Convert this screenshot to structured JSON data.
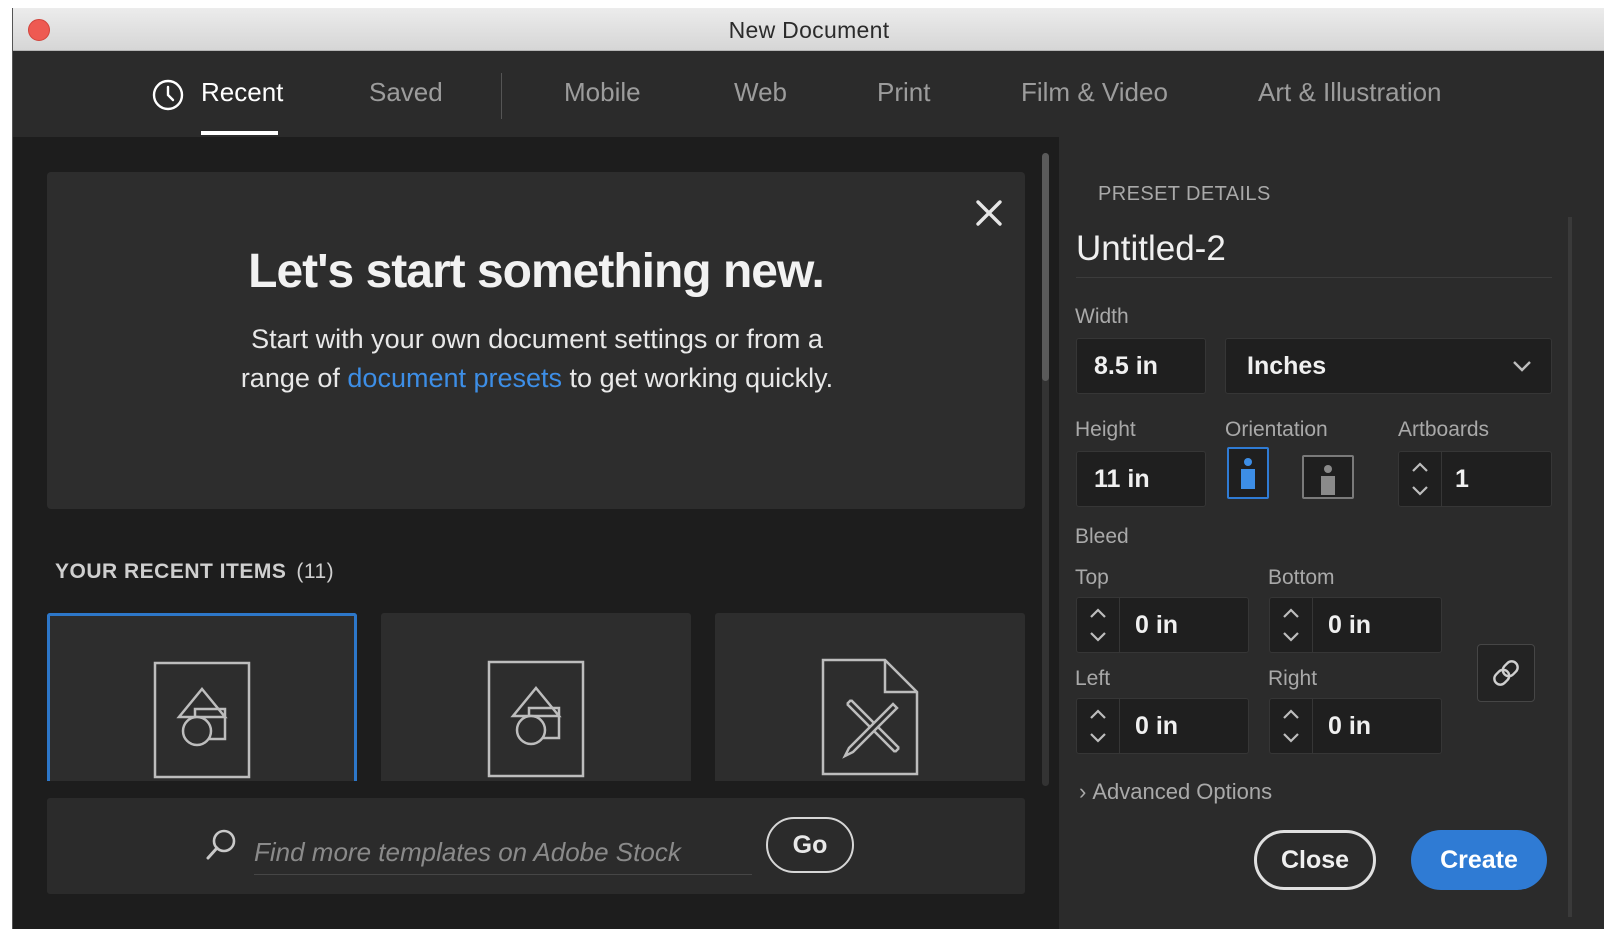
{
  "window": {
    "title": "New Document"
  },
  "tabs": [
    {
      "label": "Recent",
      "active": true
    },
    {
      "label": "Saved"
    },
    {
      "label": "Mobile"
    },
    {
      "label": "Web"
    },
    {
      "label": "Print"
    },
    {
      "label": "Film & Video"
    },
    {
      "label": "Art & Illustration"
    }
  ],
  "hero": {
    "title": "Let's start something new.",
    "text_before": "Start with your own document settings or from a range of",
    "link": "document presets",
    "text_after": "to get working quickly."
  },
  "recent": {
    "heading": "YOUR RECENT ITEMS",
    "count": "(11)",
    "items": [
      {
        "icon": "shapes-document-icon",
        "selected": true
      },
      {
        "icon": "shapes-document-icon",
        "selected": false
      },
      {
        "icon": "ruler-pencil-document-icon",
        "selected": false
      }
    ]
  },
  "stock": {
    "placeholder": "Find more templates on Adobe Stock",
    "go_label": "Go"
  },
  "preset": {
    "heading": "PRESET DETAILS",
    "name": "Untitled-2",
    "width_label": "Width",
    "width_value": "8.5 in",
    "units_value": "Inches",
    "height_label": "Height",
    "height_value": "11 in",
    "orientation_label": "Orientation",
    "orientation_selected": "portrait",
    "artboards_label": "Artboards",
    "artboards_value": "1",
    "bleed_label": "Bleed",
    "top_label": "Top",
    "top_value": "0 in",
    "bottom_label": "Bottom",
    "bottom_value": "0 in",
    "left_label": "Left",
    "left_value": "0 in",
    "right_label": "Right",
    "right_value": "0 in",
    "advanced_label": "Advanced Options",
    "close_label": "Close",
    "create_label": "Create"
  },
  "colors": {
    "accent": "#2f7bd4",
    "link": "#3d8ee6",
    "selection_border": "#2d77c9"
  }
}
